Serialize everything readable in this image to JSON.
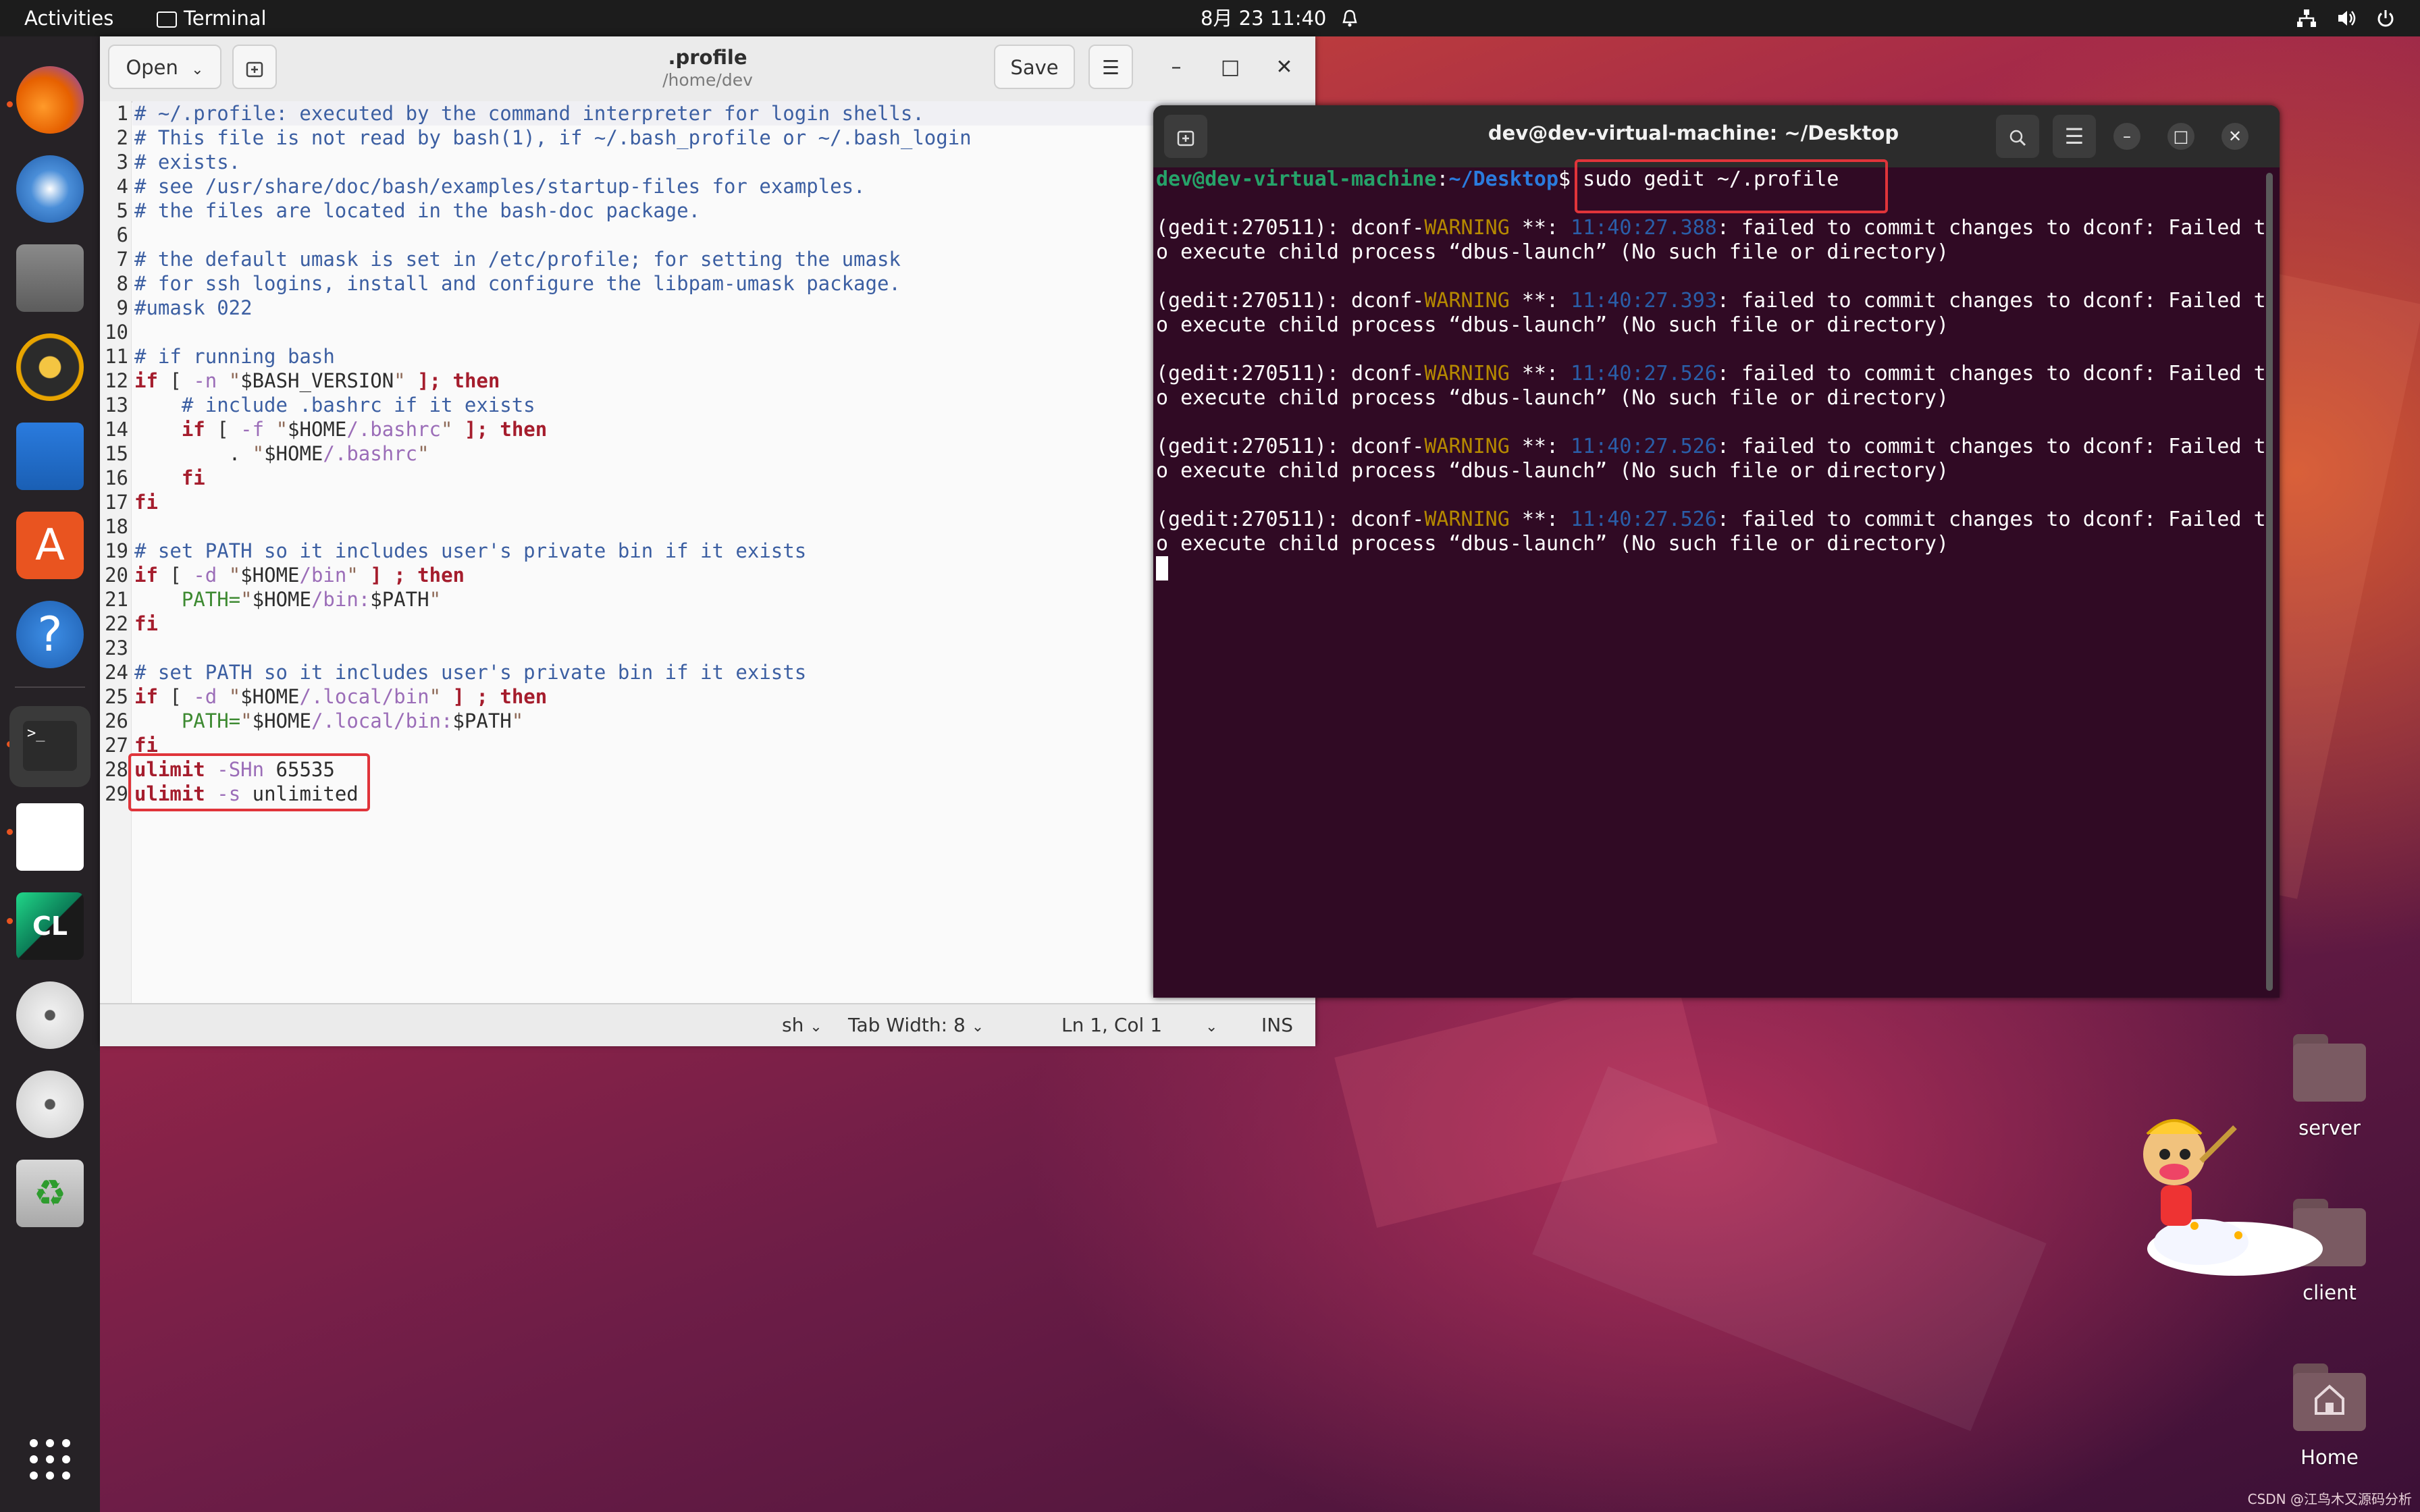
{
  "topbar": {
    "activities": "Activities",
    "app_name": "Terminal",
    "clock": "8月 23  11:40"
  },
  "dock": {
    "apps": [
      {
        "name": "firefox-icon"
      },
      {
        "name": "thunderbird-icon"
      },
      {
        "name": "files-icon"
      },
      {
        "name": "rhythmbox-icon"
      },
      {
        "name": "writer-icon"
      },
      {
        "name": "app-center-icon"
      },
      {
        "name": "help-icon"
      },
      {
        "name": "terminal-icon"
      },
      {
        "name": "text-editor-icon"
      },
      {
        "name": "clion-icon"
      },
      {
        "name": "disc-icon"
      },
      {
        "name": "disc-icon"
      },
      {
        "name": "trash-icon"
      }
    ],
    "show_apps": "show-apps-icon"
  },
  "gedit": {
    "open_label": "Open",
    "save_label": "Save",
    "title": ".profile",
    "subtitle": "/home/dev",
    "lines": [
      "# ~/.profile: executed by the command interpreter for login shells.",
      "# This file is not read by bash(1), if ~/.bash_profile or ~/.bash_login",
      "# exists.",
      "# see /usr/share/doc/bash/examples/startup-files for examples.",
      "# the files are located in the bash-doc package.",
      "",
      "# the default umask is set in /etc/profile; for setting the umask",
      "# for ssh logins, install and configure the libpam-umask package.",
      "#umask 022",
      "",
      "# if running bash",
      "if [ -n \"$BASH_VERSION\" ]; then",
      "    # include .bashrc if it exists",
      "    if [ -f \"$HOME/.bashrc\" ]; then",
      "        . \"$HOME/.bashrc\"",
      "    fi",
      "fi",
      "",
      "# set PATH so it includes user's private bin if it exists",
      "if [ -d \"$HOME/bin\" ] ; then",
      "    PATH=\"$HOME/bin:$PATH\"",
      "fi",
      "",
      "# set PATH so it includes user's private bin if it exists",
      "if [ -d \"$HOME/.local/bin\" ] ; then",
      "    PATH=\"$HOME/.local/bin:$PATH\"",
      "fi",
      "ulimit -SHn 65535",
      "ulimit -s unlimited"
    ],
    "status": {
      "lang": "sh",
      "tab_width": "Tab Width: 8",
      "position": "Ln 1, Col 1",
      "mode": "INS"
    }
  },
  "terminal": {
    "title": "dev@dev-virtual-machine: ~/Desktop",
    "prompt_user": "dev@dev-virtual-machine",
    "prompt_sep": ":",
    "prompt_path": "~/Desktop",
    "prompt_dollar": "$",
    "command": " sudo gedit ~/.profile",
    "warnings": [
      {
        "prefix": "(gedit:270511): dconf-",
        "level": "WARNING",
        "mid": " **: ",
        "time": "11:40:27.388",
        "msg": ": failed to commit changes to dconf: Failed t",
        "cont": "o execute child process “dbus-launch” (No such file or directory)"
      },
      {
        "prefix": "(gedit:270511): dconf-",
        "level": "WARNING",
        "mid": " **: ",
        "time": "11:40:27.393",
        "msg": ": failed to commit changes to dconf: Failed t",
        "cont": "o execute child process “dbus-launch” (No such file or directory)"
      },
      {
        "prefix": "(gedit:270511): dconf-",
        "level": "WARNING",
        "mid": " **: ",
        "time": "11:40:27.526",
        "msg": ": failed to commit changes to dconf: Failed t",
        "cont": "o execute child process “dbus-launch” (No such file or directory)"
      },
      {
        "prefix": "(gedit:270511): dconf-",
        "level": "WARNING",
        "mid": " **: ",
        "time": "11:40:27.526",
        "msg": ": failed to commit changes to dconf: Failed t",
        "cont": "o execute child process “dbus-launch” (No such file or directory)"
      },
      {
        "prefix": "(gedit:270511): dconf-",
        "level": "WARNING",
        "mid": " **: ",
        "time": "11:40:27.526",
        "msg": ": failed to commit changes to dconf: Failed t",
        "cont": "o execute child process “dbus-launch” (No such file or directory)"
      }
    ]
  },
  "desktop": {
    "icons": [
      {
        "label": "server"
      },
      {
        "label": "client"
      },
      {
        "label": "Home"
      }
    ],
    "watermark": "CSDN @江鸟木又源码分析"
  }
}
